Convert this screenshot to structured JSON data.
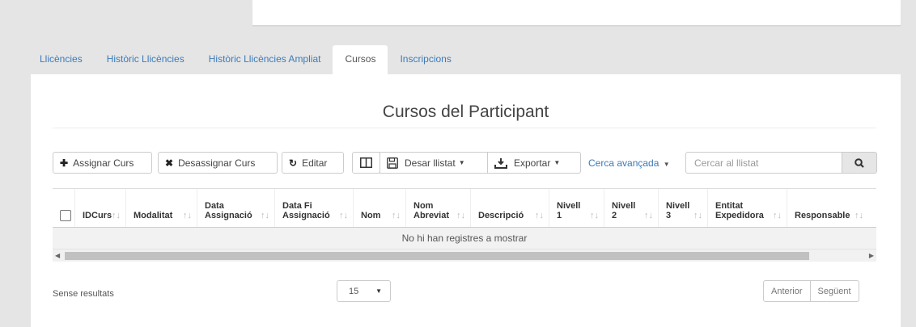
{
  "tabs": [
    {
      "label": "Llicències"
    },
    {
      "label": "Històric Llicències"
    },
    {
      "label": "Històric Llicències Ampliat"
    },
    {
      "label": "Cursos",
      "active": true
    },
    {
      "label": "Inscripcions"
    }
  ],
  "panel": {
    "title": "Cursos del Participant"
  },
  "toolbar": {
    "assign_label": "Assignar Curs",
    "unassign_label": "Desassignar Curs",
    "edit_label": "Editar",
    "save_list_label": "Desar llistat",
    "export_label": "Exportar",
    "advanced_search_label": "Cerca avançada",
    "search_placeholder": "Cercar al llistat"
  },
  "table": {
    "columns": [
      {
        "l1": "ID",
        "l2": "Curs"
      },
      {
        "l1": "",
        "l2": "Modalitat"
      },
      {
        "l1": "Data",
        "l2": "Assignació"
      },
      {
        "l1": "Data Fi",
        "l2": "Assignació"
      },
      {
        "l1": "",
        "l2": "Nom"
      },
      {
        "l1": "Nom",
        "l2": "Abreviat"
      },
      {
        "l1": "",
        "l2": "Descripció"
      },
      {
        "l1": "Nivell",
        "l2": "1"
      },
      {
        "l1": "Nivell",
        "l2": "2"
      },
      {
        "l1": "Nivell",
        "l2": "3"
      },
      {
        "l1": "Entitat",
        "l2": "Expedidora"
      },
      {
        "l1": "",
        "l2": "Responsable"
      }
    ],
    "empty_message": "No hi han registres a mostrar"
  },
  "footer": {
    "results_text": "Sense resultats",
    "page_size": "15",
    "prev_label": "Anterior",
    "next_label": "Següent"
  }
}
